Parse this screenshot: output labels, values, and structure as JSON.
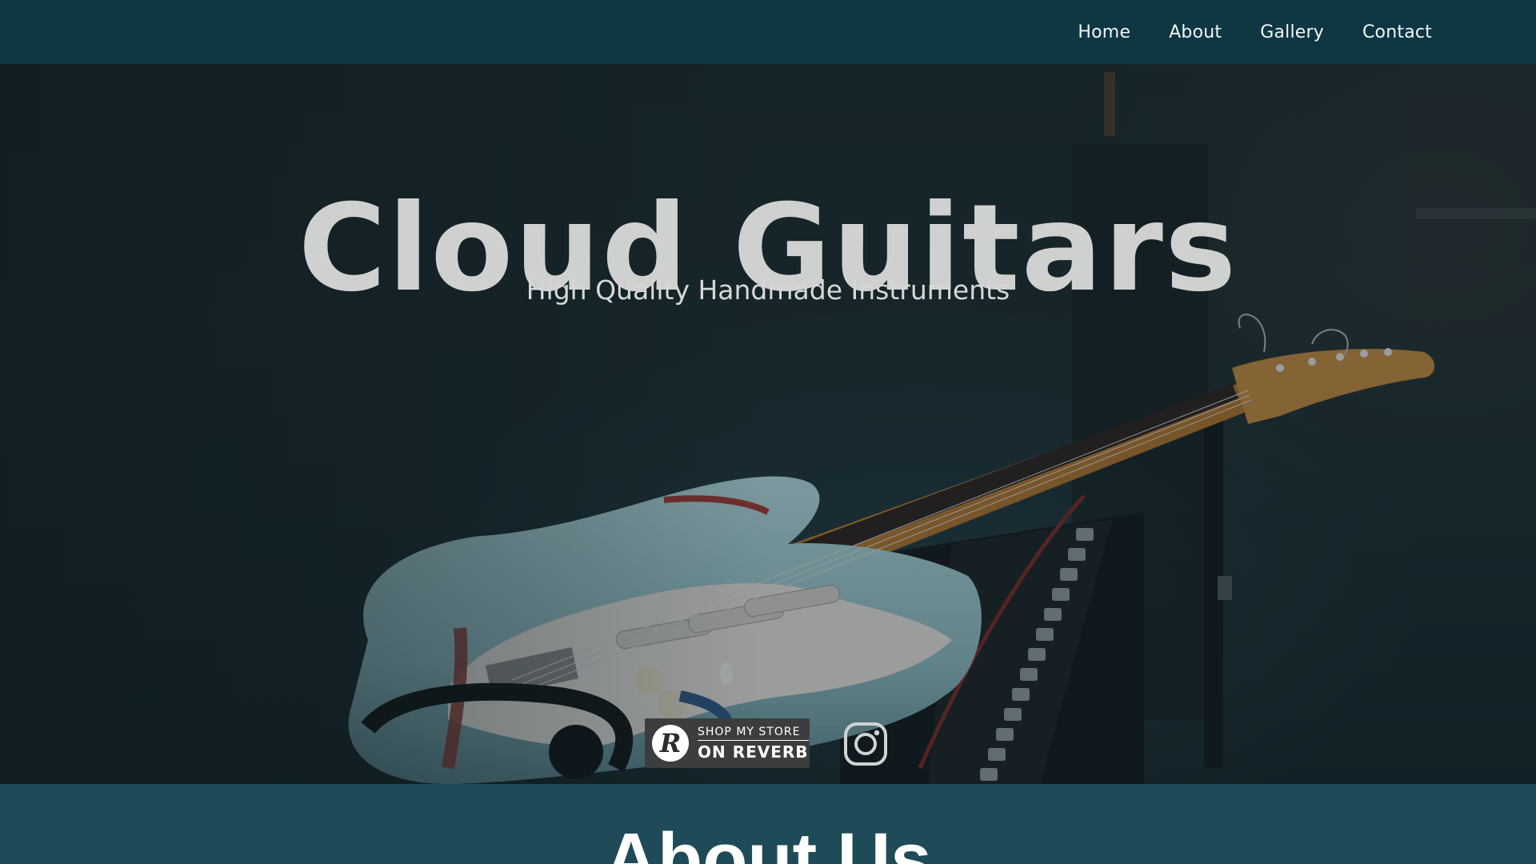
{
  "nav": {
    "links": [
      "Home",
      "About",
      "Gallery",
      "Contact"
    ]
  },
  "hero": {
    "title": "Cloud Guitars",
    "subtitle": "High Quality Handmade Instruments",
    "background_image": "electric-guitar-on-amplifier-photo"
  },
  "social": {
    "reverb": {
      "logo_letter": "R",
      "line1": "SHOP MY STORE",
      "line2": "ON REVERB"
    },
    "instagram_icon": "instagram-icon"
  },
  "about": {
    "heading": "About Us"
  },
  "colors": {
    "navbar": "#0e3742",
    "about_bg": "#1f4b58",
    "title": "#cfd0d0",
    "guitar_body": "#a7cfd6"
  }
}
